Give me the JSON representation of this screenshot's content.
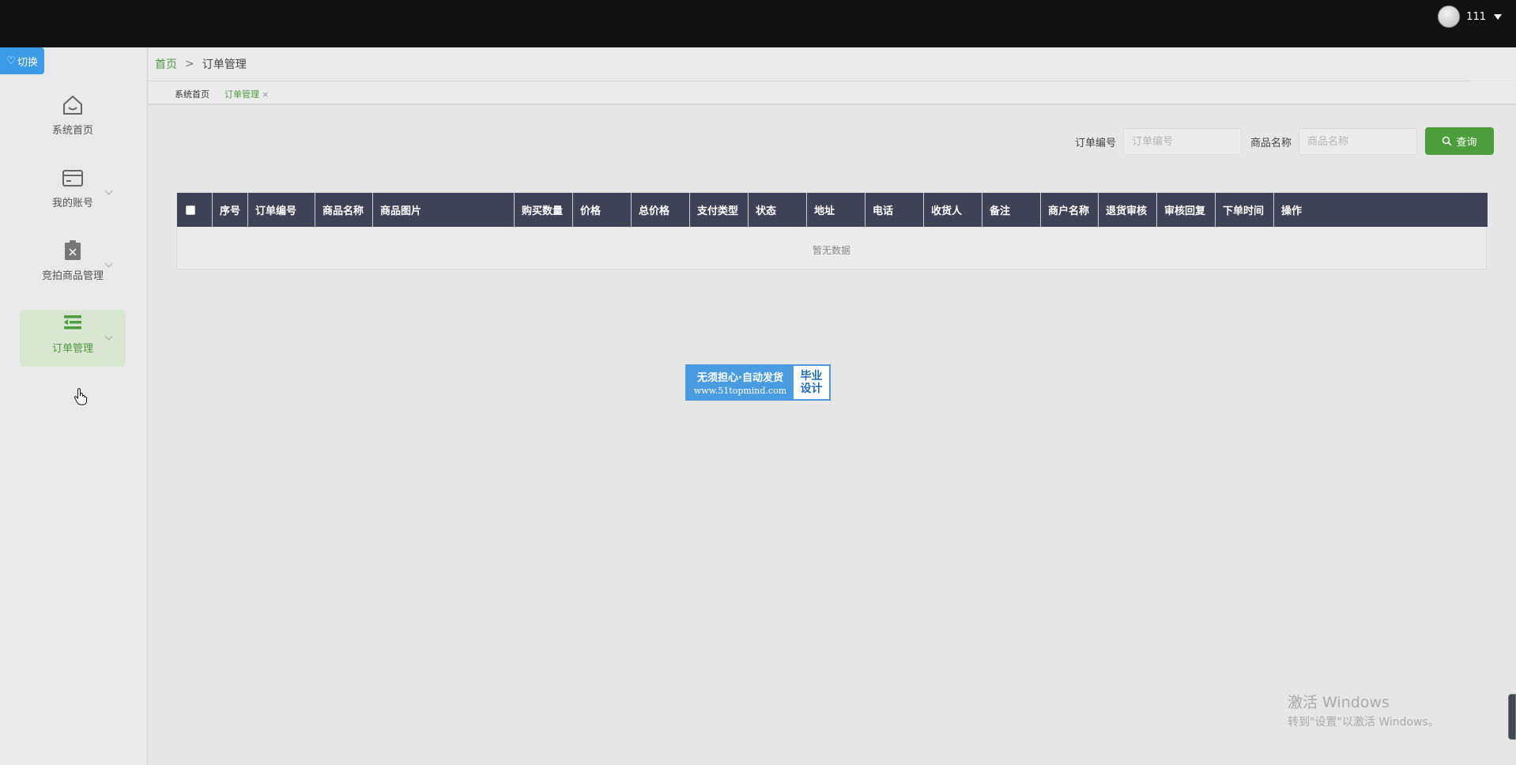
{
  "header": {
    "username": "111"
  },
  "sidebar": {
    "switch_label": "切换",
    "items": [
      {
        "label": "系统首页",
        "icon": "home-icon"
      },
      {
        "label": "我的账号",
        "icon": "card-icon"
      },
      {
        "label": "竞拍商品管理",
        "icon": "clipboard-x-icon"
      },
      {
        "label": "订单管理",
        "icon": "list-indent-icon",
        "active": true
      }
    ]
  },
  "breadcrumb": {
    "home": "首页",
    "separator": ">",
    "current": "订单管理"
  },
  "tabs": [
    {
      "label": "系统首页"
    },
    {
      "label": "订单管理",
      "active": true,
      "close": "×"
    }
  ],
  "search": {
    "order_no_label": "订单编号",
    "order_no_placeholder": "订单编号",
    "product_name_label": "商品名称",
    "product_name_placeholder": "商品名称",
    "query_button": "查询"
  },
  "table": {
    "columns": [
      "序号",
      "订单编号",
      "商品名称",
      "商品图片",
      "购买数量",
      "价格",
      "总价格",
      "支付类型",
      "状态",
      "地址",
      "电话",
      "收货人",
      "备注",
      "商户名称",
      "退货审核",
      "审核回复",
      "下单时间",
      "操作"
    ],
    "empty_text": "暂无数据"
  },
  "badge": {
    "line1": "无须担心·自动发货",
    "line2": "www.51topmind.com",
    "right1": "毕业",
    "right2": "设计"
  },
  "activation": {
    "title": "激活 Windows",
    "subtitle": "转到\"设置\"以激活 Windows。"
  },
  "colors": {
    "accent_green": "#4c9d3c",
    "header_bg": "#121212",
    "table_head": "#3f4257",
    "switch_blue": "#3a9be8"
  }
}
